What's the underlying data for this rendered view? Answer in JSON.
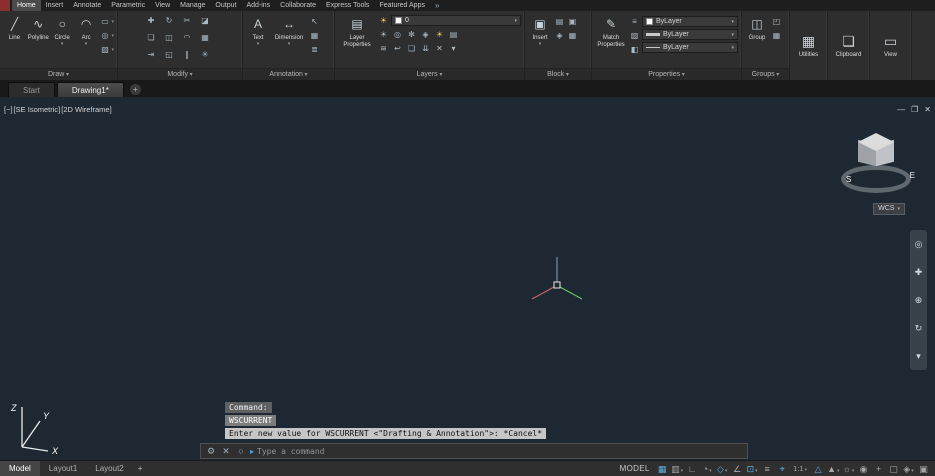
{
  "colors": {
    "accent": "#4aa3e0",
    "viewport_bg": "#1e2833",
    "ribbon_bg": "#2e2e2e"
  },
  "menubar": {
    "tabs": [
      "Home",
      "Insert",
      "Annotate",
      "Parametric",
      "View",
      "Manage",
      "Output",
      "Add-ins",
      "Collaborate",
      "Express Tools",
      "Featured Apps"
    ],
    "share_glyph": "»"
  },
  "ribbon": {
    "draw": {
      "footer": "Draw",
      "tools": [
        {
          "label": "Line",
          "glyph": "╱"
        },
        {
          "label": "Polyline",
          "glyph": "∿"
        },
        {
          "label": "Circle",
          "glyph": "○"
        },
        {
          "label": "Arc",
          "glyph": "◠"
        }
      ],
      "side": [
        {
          "name": "rectangle",
          "glyph": "▭"
        },
        {
          "name": "ellipse",
          "glyph": "◎"
        },
        {
          "name": "hatch",
          "glyph": "▨"
        }
      ]
    },
    "modify": {
      "footer": "Modify",
      "icons": [
        {
          "name": "move",
          "glyph": "✚"
        },
        {
          "name": "rotate",
          "glyph": "↻"
        },
        {
          "name": "trim",
          "glyph": "✂"
        },
        {
          "name": "erase",
          "glyph": "◪"
        },
        {
          "name": "copy",
          "glyph": "❏"
        },
        {
          "name": "mirror",
          "glyph": "◫"
        },
        {
          "name": "fillet",
          "glyph": "◠"
        },
        {
          "name": "array",
          "glyph": "▦"
        },
        {
          "name": "stretch",
          "glyph": "⇥"
        },
        {
          "name": "scale",
          "glyph": "◱"
        },
        {
          "name": "offset",
          "glyph": "∥"
        },
        {
          "name": "explode",
          "glyph": "✳"
        }
      ]
    },
    "annotation": {
      "footer": "Annotation",
      "text": {
        "label": "Text",
        "glyph": "A"
      },
      "dimension": {
        "label": "Dimension",
        "glyph": "↔"
      },
      "side": [
        {
          "name": "leader",
          "glyph": "↖"
        },
        {
          "name": "table",
          "glyph": "▦"
        },
        {
          "name": "markup",
          "glyph": "≣"
        }
      ]
    },
    "layers": {
      "footer": "Layers",
      "big": {
        "label": "Layer Properties",
        "glyph": "▤"
      },
      "state_icon": "☀",
      "current_layer": "0",
      "row2": [
        {
          "name": "layer-off",
          "glyph": "☀"
        },
        {
          "name": "layer-isolate",
          "glyph": "◎"
        },
        {
          "name": "layer-freeze",
          "glyph": "✻"
        },
        {
          "name": "layer-lock",
          "glyph": "◈"
        },
        {
          "name": "layer-on",
          "glyph": "☀"
        },
        {
          "name": "layer-walk",
          "glyph": "▤"
        }
      ],
      "row3": [
        {
          "name": "layer-match",
          "glyph": "≋"
        },
        {
          "name": "layer-previous",
          "glyph": "↩"
        },
        {
          "name": "layer-copy",
          "glyph": "❏"
        },
        {
          "name": "layer-merge",
          "glyph": "⇊"
        },
        {
          "name": "layer-delete",
          "glyph": "✕"
        },
        {
          "name": "layer-settings",
          "glyph": "▾"
        }
      ]
    },
    "block": {
      "footer": "Block",
      "big": {
        "label": "Insert",
        "glyph": "▣"
      },
      "side": [
        {
          "name": "edit-attribute",
          "glyph": "▤"
        },
        {
          "name": "create-block",
          "glyph": "▣"
        },
        {
          "name": "define-attributes",
          "glyph": "◈"
        },
        {
          "name": "manage-attributes",
          "glyph": "▦"
        }
      ]
    },
    "properties": {
      "footer": "Properties",
      "big": {
        "label": "Match Properties",
        "glyph": "✎"
      },
      "col": [
        {
          "name": "properties-list",
          "glyph": "≡"
        },
        {
          "name": "transparency",
          "glyph": "▨"
        },
        {
          "name": "pickadd",
          "glyph": "◧"
        }
      ],
      "dropdowns": [
        {
          "name": "object-color",
          "value": "ByLayer"
        },
        {
          "name": "lineweight",
          "value": "ByLayer"
        },
        {
          "name": "linetype",
          "value": "ByLayer"
        }
      ]
    },
    "groups": {
      "footer": "Groups",
      "big": {
        "label": "Group",
        "glyph": "◫"
      },
      "side": [
        {
          "name": "ungroup",
          "glyph": "◰"
        },
        {
          "name": "group-edit",
          "glyph": "▦"
        }
      ]
    },
    "utilities": {
      "label": "Utilities",
      "glyph": "▦"
    },
    "clipboard": {
      "label": "Clipboard",
      "glyph": "❏"
    },
    "view_panel": {
      "label": "View",
      "glyph": "▭"
    }
  },
  "file_tabs": {
    "start": "Start",
    "drawing": "Drawing1*",
    "new_tab": "+"
  },
  "viewport": {
    "controls": {
      "collapse": "[−]",
      "view": "[SE Isometric]",
      "style": "[2D Wireframe]"
    },
    "window_controls": {
      "minimize": "—",
      "restore": "❐",
      "close": "✕"
    },
    "viewcube": {
      "south": "S",
      "east": "E",
      "wcs_label": "WCS"
    },
    "ucs": {
      "x": "X",
      "y": "Y",
      "z": "Z"
    },
    "navbar": [
      {
        "name": "navigation-wheel",
        "glyph": "◎"
      },
      {
        "name": "pan",
        "glyph": "✚"
      },
      {
        "name": "zoom",
        "glyph": "⊕"
      },
      {
        "name": "orbit",
        "glyph": "↻"
      },
      {
        "name": "navbar-more",
        "glyph": "▾"
      }
    ]
  },
  "command": {
    "history": [
      "Command:",
      "WSCURRENT",
      "Enter new value for WSCURRENT <\"Drafting & Annotation\">: *Cancel*"
    ],
    "placeholder": "Type a command",
    "icons": {
      "customize": "⚙",
      "close": "✕",
      "search": "○",
      "prompt": "▸"
    }
  },
  "statusbar": {
    "tabs": [
      "Model",
      "Layout1",
      "Layout2"
    ],
    "new_layout": "+",
    "model": "MODEL",
    "icons": [
      {
        "name": "grid",
        "glyph": "▦"
      },
      {
        "name": "snap-mode",
        "glyph": "▥"
      },
      {
        "name": "ortho",
        "glyph": "∟"
      },
      {
        "name": "polar-tracking",
        "glyph": "◔"
      },
      {
        "name": "isodraft",
        "glyph": "◇"
      },
      {
        "name": "osnap-tracking",
        "glyph": "∠"
      },
      {
        "name": "object-snap",
        "glyph": "⊡"
      },
      {
        "name": "lineweight",
        "glyph": "≡"
      },
      {
        "name": "dynamic-input",
        "glyph": "⌖"
      },
      {
        "name": "annotation-scale",
        "glyph": "1:1"
      },
      {
        "name": "annotation-visibility",
        "glyph": "△"
      },
      {
        "name": "autoscale",
        "glyph": "▲"
      },
      {
        "name": "workspace",
        "glyph": "☼"
      },
      {
        "name": "annotation-monitor",
        "glyph": "◉"
      },
      {
        "name": "units",
        "glyph": "+"
      },
      {
        "name": "quick-properties",
        "glyph": "▢"
      },
      {
        "name": "lock-ui",
        "glyph": "◈"
      },
      {
        "name": "clean-screen",
        "glyph": "▣"
      }
    ]
  }
}
